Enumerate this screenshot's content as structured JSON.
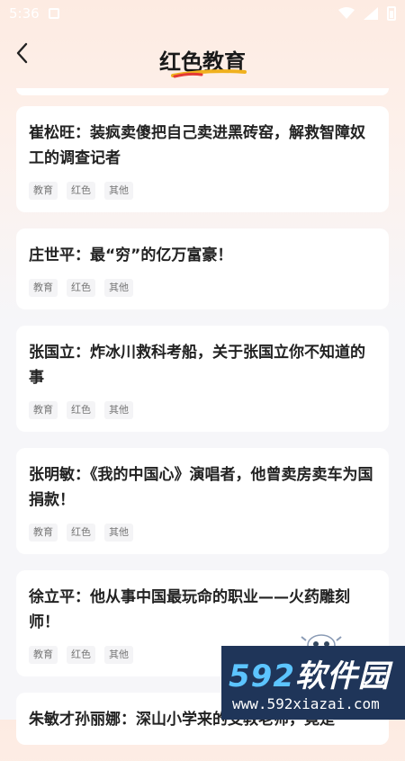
{
  "status_bar": {
    "time": "5:36"
  },
  "header": {
    "title": "红色教育"
  },
  "cards": [
    {
      "title": "崔松旺：装疯卖傻把自己卖进黑砖窑，解救智障奴工的调查记者",
      "tags": [
        "教育",
        "红色",
        "其他"
      ]
    },
    {
      "title": "庄世平：最“穷”的亿万富豪！",
      "tags": [
        "教育",
        "红色",
        "其他"
      ]
    },
    {
      "title": "张国立：炸冰川救科考船，关于张国立你不知道的事",
      "tags": [
        "教育",
        "红色",
        "其他"
      ]
    },
    {
      "title": "张明敏：《我的中国心》演唱者，他曾卖房卖车为国捐款！",
      "tags": [
        "教育",
        "红色",
        "其他"
      ]
    },
    {
      "title": "徐立平：他从事中国最玩命的职业——火药雕刻师！",
      "tags": [
        "教育",
        "红色",
        "其他"
      ]
    },
    {
      "title": "朱敏才孙丽娜：深山小学来的支教老师，竟是",
      "tags": []
    }
  ],
  "watermark": {
    "brand_prefix": "592",
    "brand_suffix": "软件园",
    "url": "www.592xiazai.com"
  }
}
